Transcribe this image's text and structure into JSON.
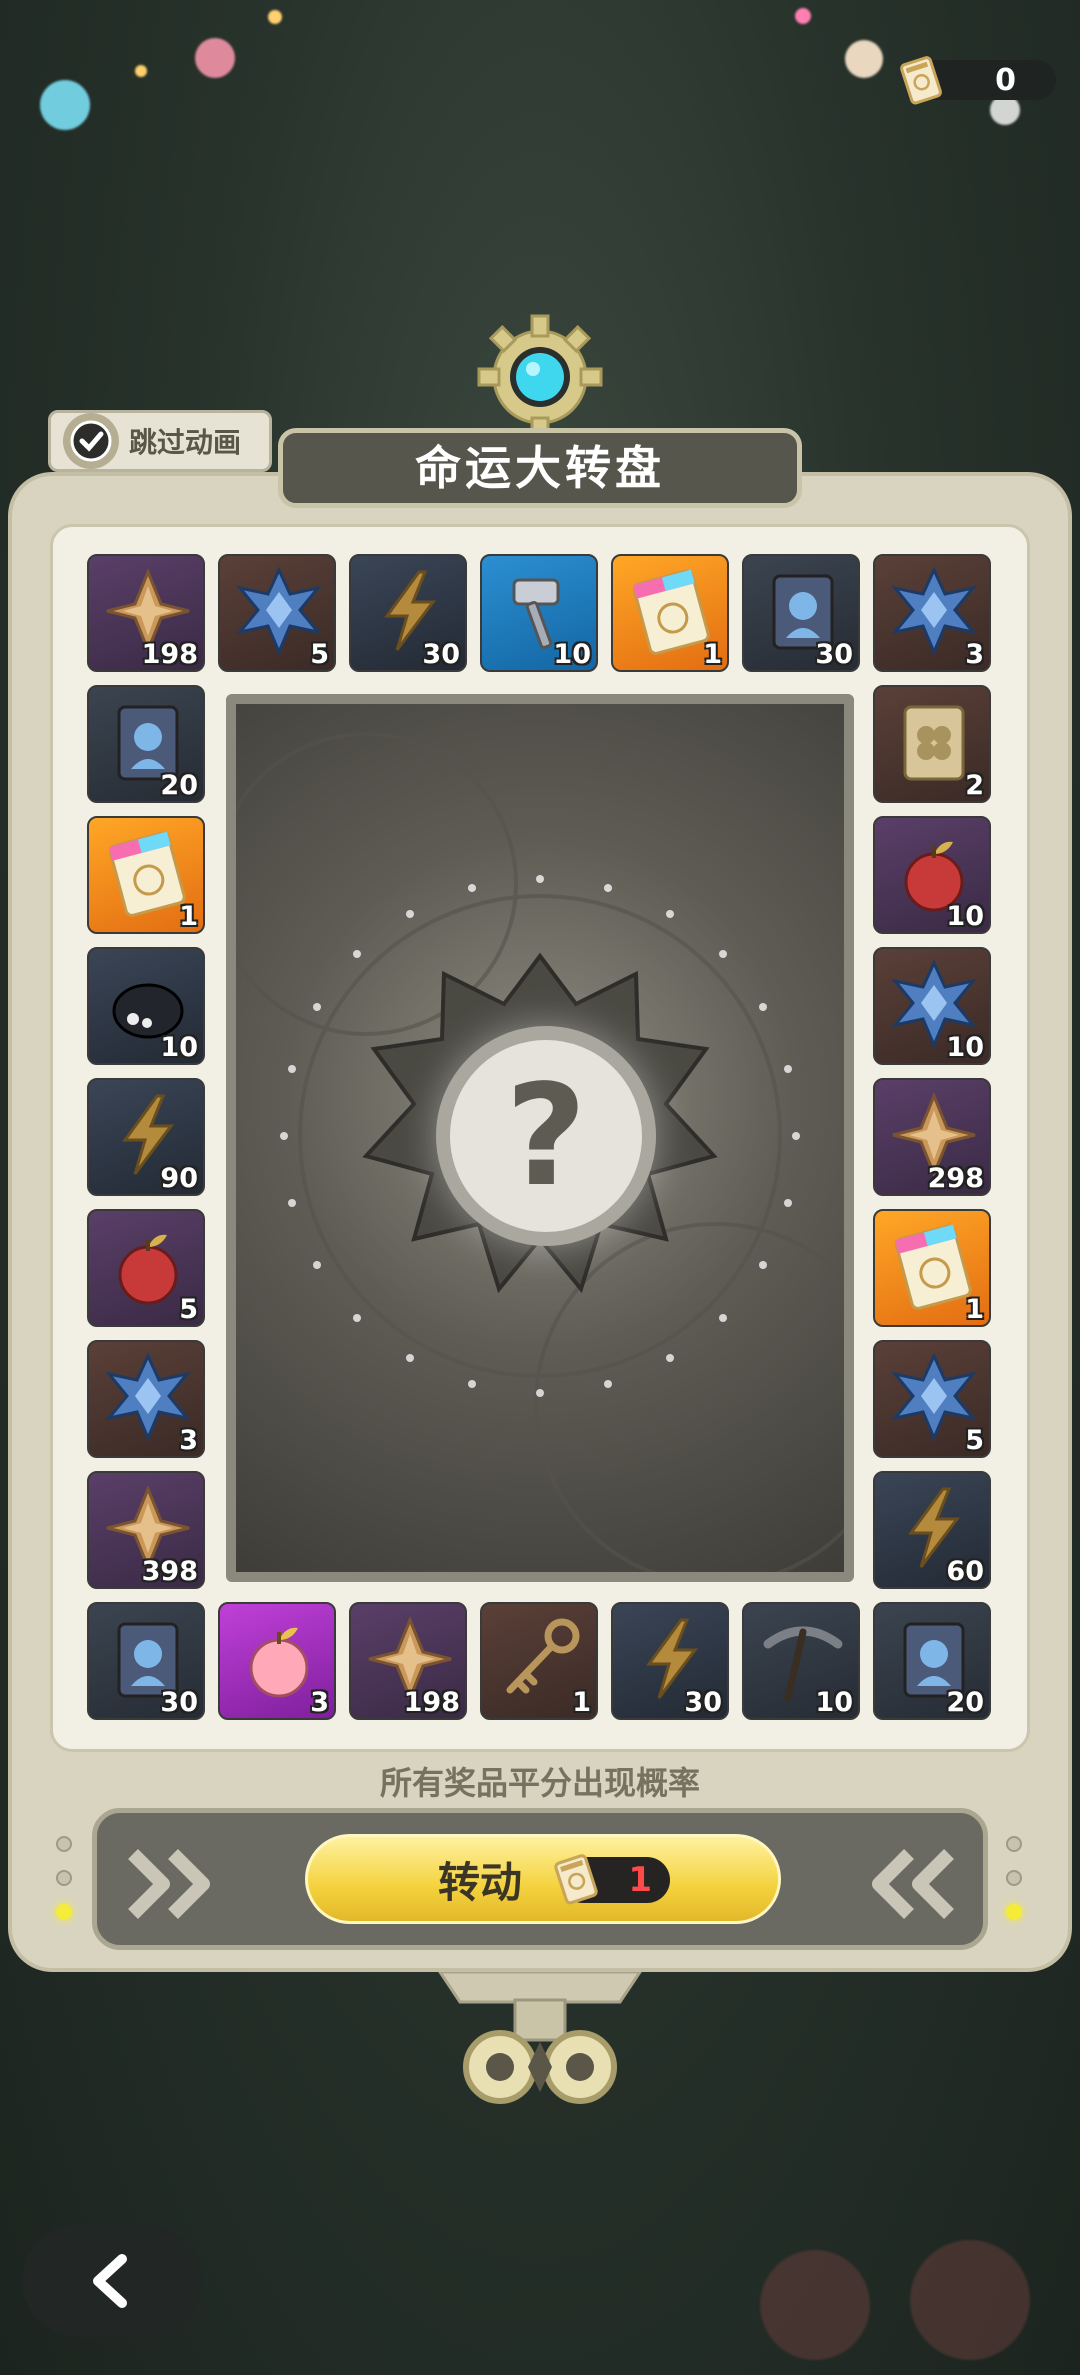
{
  "currency": {
    "icon": "ticket-icon",
    "amount": "0"
  },
  "skip_animation": {
    "label": "跳过动画",
    "checked": true
  },
  "title": "命运大转盘",
  "colors": {
    "accent": "#f4d23c",
    "frame": "#d9d4bf",
    "plate": "#57564d",
    "cost": "#ff4a4a"
  },
  "prizes": {
    "top": [
      {
        "item": "gold-star-shard",
        "count": "198"
      },
      {
        "item": "blue-crystal",
        "count": "5"
      },
      {
        "item": "lightning-bolt",
        "count": "30"
      },
      {
        "item": "hammer",
        "count": "10"
      },
      {
        "item": "rainbow-ticket",
        "count": "1"
      },
      {
        "item": "character-card",
        "count": "30"
      },
      {
        "item": "blue-crystal",
        "count": "3"
      }
    ],
    "left": [
      {
        "item": "character-card",
        "count": "20"
      },
      {
        "item": "rainbow-ticket",
        "count": "1"
      },
      {
        "item": "black-creature",
        "count": "10"
      },
      {
        "item": "lightning-bolt",
        "count": "90"
      },
      {
        "item": "red-apple",
        "count": "5"
      },
      {
        "item": "blue-crystal",
        "count": "3"
      },
      {
        "item": "gold-star-shard",
        "count": "398"
      }
    ],
    "right": [
      {
        "item": "clover-card",
        "count": "2"
      },
      {
        "item": "red-apple",
        "count": "10"
      },
      {
        "item": "blue-crystal",
        "count": "10"
      },
      {
        "item": "gold-star-shard",
        "count": "298"
      },
      {
        "item": "rainbow-ticket",
        "count": "1"
      },
      {
        "item": "blue-crystal",
        "count": "5"
      },
      {
        "item": "lightning-bolt",
        "count": "60"
      }
    ],
    "bottom": [
      {
        "item": "character-card",
        "count": "30"
      },
      {
        "item": "pink-apple",
        "count": "3"
      },
      {
        "item": "gold-star-shard",
        "count": "198"
      },
      {
        "item": "key",
        "count": "1"
      },
      {
        "item": "lightning-bolt",
        "count": "30"
      },
      {
        "item": "pickaxe",
        "count": "10"
      },
      {
        "item": "character-card",
        "count": "20"
      }
    ]
  },
  "center": {
    "symbol": "?"
  },
  "hint": "所有奖品平分出现概率",
  "spin": {
    "label": "转动",
    "cost": "1",
    "cost_icon": "ticket-icon"
  },
  "back": {
    "icon": "chevron-left-icon"
  }
}
